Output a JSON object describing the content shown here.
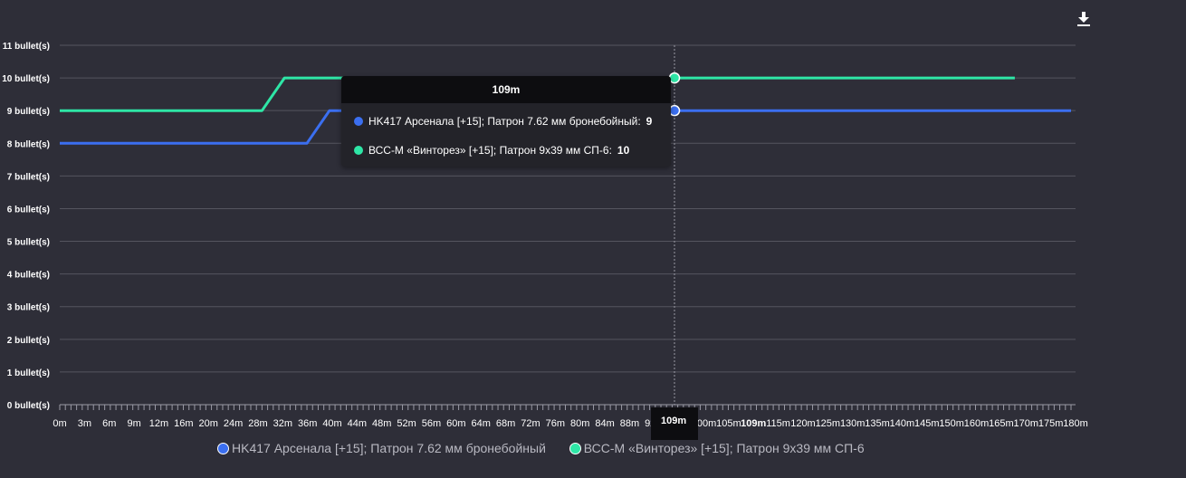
{
  "toolbar": {
    "download_icon": "download-icon"
  },
  "tooltip": {
    "title": "109m",
    "rows": [
      {
        "label": "HK417 Арсенала [+15]; Патрон 7.62 мм бронебойный:",
        "value": "9",
        "color": "#3b6ff0"
      },
      {
        "label": "ВСС-М «Винторез» [+15]; Патрон 9х39 мм СП-6:",
        "value": "10",
        "color": "#2ee6a6"
      }
    ]
  },
  "crosshair_label": "109m",
  "chart_data": {
    "type": "line",
    "title": "",
    "xlabel": "",
    "ylabel": "",
    "x_ticks": [
      "0m",
      "3m",
      "6m",
      "9m",
      "12m",
      "16m",
      "20m",
      "24m",
      "28m",
      "32m",
      "36m",
      "40m",
      "44m",
      "48m",
      "52m",
      "56m",
      "60m",
      "64m",
      "68m",
      "72m",
      "76m",
      "80m",
      "84m",
      "88m",
      "92m",
      "96m",
      "100m",
      "105m",
      "109m",
      "115m",
      "120m",
      "125m",
      "130m",
      "135m",
      "140m",
      "145m",
      "150m",
      "160m",
      "165m",
      "170m",
      "175m",
      "180m"
    ],
    "y_ticks": [
      "0 bullet(s)",
      "1 bullet(s)",
      "2 bullet(s)",
      "3 bullet(s)",
      "4 bullet(s)",
      "5 bullet(s)",
      "6 bullet(s)",
      "7 bullet(s)",
      "8 bullet(s)",
      "9 bullet(s)",
      "10 bullet(s)",
      "11 bullet(s)"
    ],
    "ylim": [
      0,
      11
    ],
    "grid": true,
    "legend_position": "bottom",
    "highlight_x": "109m",
    "series": [
      {
        "name": "HK417 Арсенала [+15]; Патрон 7.62 мм бронебойный",
        "color": "#3b6ff0",
        "x": [
          "0m",
          "44m",
          "48m",
          "180m"
        ],
        "values": [
          8,
          8,
          9,
          9
        ]
      },
      {
        "name": "ВСС-М «Винторез» [+15]; Патрон 9х39 мм СП-6",
        "color": "#2ee6a6",
        "x": [
          "0m",
          "36m",
          "40m",
          "170m"
        ],
        "values": [
          9,
          9,
          10,
          10
        ]
      }
    ]
  }
}
